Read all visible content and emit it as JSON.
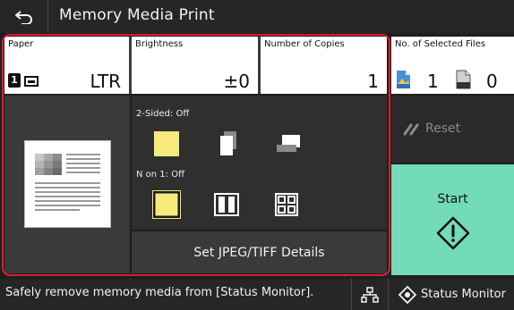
{
  "title_bar": {
    "title": "Memory Media Print",
    "back_icon": "back-arrow-icon"
  },
  "tiles": {
    "paper": {
      "label": "Paper",
      "drawer_number": "1",
      "value": "LTR",
      "icon": "paper-drawer-icon"
    },
    "brightness": {
      "label": "Brightness",
      "value": "±0"
    },
    "copies": {
      "label": "Number of Copies",
      "value": "1"
    },
    "selected_files": {
      "label": "No. of Selected Files",
      "image_count": "1",
      "pdf_count": "0",
      "image_icon": "image-file-icon",
      "pdf_icon": "pdf-file-icon"
    }
  },
  "layout": {
    "two_sided_label": "2-Sided: Off",
    "n_on_1_label": "N on 1: Off",
    "two_sided_options": [
      "one-sided-icon",
      "two-sided-long-edge-icon",
      "two-sided-short-edge-icon"
    ],
    "n_on_1_options": [
      "one-page-icon",
      "two-on-one-icon",
      "four-on-one-icon"
    ],
    "selected_two_sided": 0,
    "selected_n_on_1": 0
  },
  "jpeg_button": {
    "label": "Set JPEG/TIFF Details"
  },
  "reset_button": {
    "label": "Reset",
    "icon": "reset-icon"
  },
  "start_button": {
    "label": "Start",
    "icon": "start-diamond-icon"
  },
  "status_bar": {
    "message": "Safely remove memory media from [Status Monitor].",
    "network_icon": "network-icon",
    "status_monitor_label": "Status Monitor",
    "status_monitor_icon": "status-monitor-icon"
  },
  "colors": {
    "selection_outline": "#e21b2a",
    "start_button": "#73dbb7",
    "selected_option": "#f7ea7d",
    "background": "#1f1f1f"
  }
}
